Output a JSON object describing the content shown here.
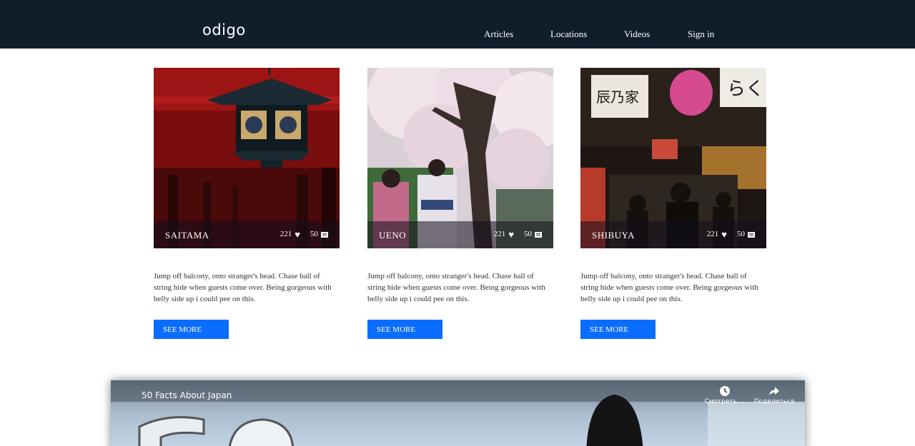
{
  "header": {
    "logo": "odigo",
    "nav": [
      "Articles",
      "Locations",
      "Videos",
      "Sign in"
    ]
  },
  "cards": [
    {
      "place": "SAITAMA",
      "likes": "221",
      "comments": "50",
      "description": "Jump off balcony, onto stranger's head. Chase ball of string hide when guests come over. Being gorgeous with belly side up i could pee on this.",
      "button": "SEE MORE",
      "image": "red-lantern-torii-photo"
    },
    {
      "place": "UENO",
      "likes": "221",
      "comments": "50",
      "description": "Jump off balcony, onto stranger's head. Chase ball of string hide when guests come over. Being gorgeous with belly side up i could pee on this.",
      "button": "SEE MORE",
      "image": "cherry-blossom-kimono-photo"
    },
    {
      "place": "SHIBUYA",
      "likes": "221",
      "comments": "50",
      "description": "Jump off balcony, onto stranger's head. Chase ball of string hide when guests come over. Being gorgeous with belly side up i could pee on this.",
      "button": "SEE MORE",
      "image": "night-alley-signs-photo"
    }
  ],
  "video": {
    "title": "50 Facts About Japan",
    "watch_later": "Смотреть ...",
    "share": "Поделиться"
  },
  "colors": {
    "header_bg": "#101e2c",
    "button_bg": "#0b6dff"
  }
}
